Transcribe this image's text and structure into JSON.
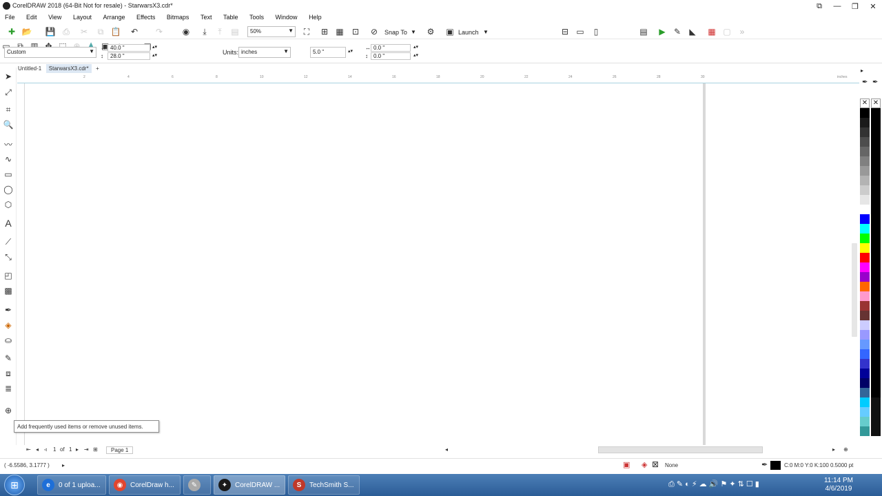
{
  "window": {
    "title": "CorelDRAW 2018 (64-Bit Not for resale) - StarwarsX3.cdr*",
    "controls": [
      "⧉",
      "—",
      "❐",
      "✕"
    ]
  },
  "menu": [
    "File",
    "Edit",
    "View",
    "Layout",
    "Arrange",
    "Effects",
    "Bitmaps",
    "Text",
    "Table",
    "Tools",
    "Window",
    "Help"
  ],
  "standard_toolbar": {
    "zoom_value": "50%",
    "snap_to_label": "Snap To",
    "launch_label": "Launch"
  },
  "property_bar": {
    "page_size_preset": "Custom",
    "width": "40.0 \"",
    "height": "28.0 \"",
    "units_label": "Units:",
    "units_value": "inches",
    "nudge": "5.0 \"",
    "dup_x": "0.0 \"",
    "dup_y": "0.0 \""
  },
  "doc_tabs": [
    {
      "label": "Untitled-1",
      "active": false
    },
    {
      "label": "StarwarsX3.cdr*",
      "active": true
    },
    {
      "label": "+",
      "active": false
    }
  ],
  "ruler": {
    "unit_label": "inches",
    "ticks": [
      "2",
      "4",
      "6",
      "8",
      "10",
      "12",
      "14",
      "16",
      "18",
      "20",
      "22",
      "24",
      "26",
      "28",
      "30"
    ]
  },
  "tooltip": "Add frequently used items or remove unused items.",
  "page_nav": {
    "current": "1",
    "of_label": "of",
    "total": "1",
    "page_tab": "Page 1"
  },
  "status": {
    "coordinates": "( -6.5586, 3.1777 )",
    "fill_none": "None",
    "outline_info": "C:0 M:0 Y:0 K:100  0.5000 pt"
  },
  "palette_colors": [
    "#000000",
    "#1a1a1a",
    "#333333",
    "#4d4d4d",
    "#666666",
    "#808080",
    "#999999",
    "#b3b3b3",
    "#cccccc",
    "#e6e6e6",
    "#ffffff",
    "#0000ff",
    "#00ffff",
    "#00ff00",
    "#ffff00",
    "#ff0000",
    "#ff00ff",
    "#9900cc",
    "#ff6600",
    "#ff99cc",
    "#993333",
    "#663333",
    "#ccccff",
    "#9999ff",
    "#6699ff",
    "#3366ff",
    "#3333cc",
    "#000099",
    "#000066",
    "#336699",
    "#00ccff",
    "#66ccff",
    "#66cccc",
    "#339999"
  ],
  "taskbar": {
    "items": [
      {
        "label": "0 of 1 uploa...",
        "icon": "ie-icon",
        "color": "#1e6fd8"
      },
      {
        "label": "CorelDraw h...",
        "icon": "chrome-icon",
        "color": "#e0452f"
      },
      {
        "label": "",
        "icon": "paint-icon",
        "color": "#aaaaaa"
      },
      {
        "label": "CorelDRAW ...",
        "icon": "coreldraw-icon",
        "color": "#1a1a1a"
      },
      {
        "label": "TechSmith S...",
        "icon": "techsmith-icon",
        "color": "#c0392b"
      }
    ],
    "time": "11:14 PM",
    "date": "4/6/2019"
  }
}
